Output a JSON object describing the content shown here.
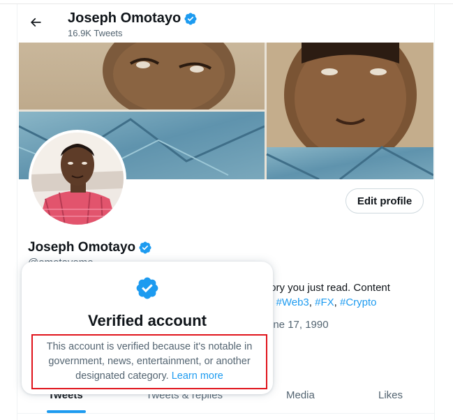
{
  "header": {
    "name": "Joseph Omotayo",
    "tweet_count": "16.9K Tweets"
  },
  "profile": {
    "name": "Joseph Omotayo",
    "handle": "@omotayomo",
    "bio_line1": "tory you just read. Content",
    "bio_line2_prefix": "n ",
    "hashtags": [
      "#Web3",
      "#FX",
      "#Crypto"
    ],
    "born_fragment": "une 17, 1990"
  },
  "actions": {
    "edit_profile_label": "Edit profile"
  },
  "tabs": [
    {
      "label": "Tweets",
      "active": true
    },
    {
      "label": "Tweets & replies",
      "active": false
    },
    {
      "label": "Media",
      "active": false
    },
    {
      "label": "Likes",
      "active": false
    }
  ],
  "verified_popover": {
    "title": "Verified account",
    "description": "This account is verified because it's notable in government, news, entertainment, or another designated category.",
    "link_label": "Learn more"
  },
  "colors": {
    "accent": "#1d9bf0",
    "highlight_border": "#e0131b",
    "secondary_text": "#536471"
  },
  "icons": {
    "back": "arrow-left-icon",
    "verified": "verified-badge-icon"
  }
}
